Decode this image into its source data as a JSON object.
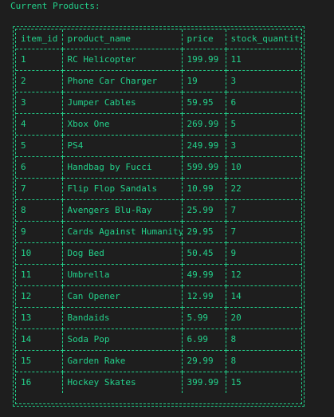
{
  "heading": "Current Products:",
  "colors": {
    "background": "#1e1e1e",
    "text": "#23d18b"
  },
  "table": {
    "columns": [
      "item_id",
      "product_name",
      "price",
      "stock_quantity"
    ],
    "rows": [
      [
        "1",
        "RC Helicopter",
        "199.99",
        "11"
      ],
      [
        "2",
        "Phone Car Charger",
        "19",
        "3"
      ],
      [
        "3",
        "Jumper Cables",
        "59.95",
        "6"
      ],
      [
        "4",
        "Xbox One",
        "269.99",
        "5"
      ],
      [
        "5",
        "PS4",
        "249.99",
        "3"
      ],
      [
        "6",
        "Handbag by Fucci",
        "599.99",
        "10"
      ],
      [
        "7",
        "Flip Flop Sandals",
        "10.99",
        "22"
      ],
      [
        "8",
        "Avengers Blu-Ray",
        "25.99",
        "7"
      ],
      [
        "9",
        "Cards Against Humanity",
        "29.95",
        "7"
      ],
      [
        "10",
        "Dog Bed",
        "50.45",
        "9"
      ],
      [
        "11",
        "Umbrella",
        "49.99",
        "12"
      ],
      [
        "12",
        "Can Opener",
        "12.99",
        "14"
      ],
      [
        "13",
        "Bandaids",
        "5.99",
        "20"
      ],
      [
        "14",
        "Soda Pop",
        "6.99",
        "8"
      ],
      [
        "15",
        "Garden Rake",
        "29.99",
        "8"
      ],
      [
        "16",
        "Hockey Skates",
        "399.99",
        "15"
      ]
    ]
  }
}
